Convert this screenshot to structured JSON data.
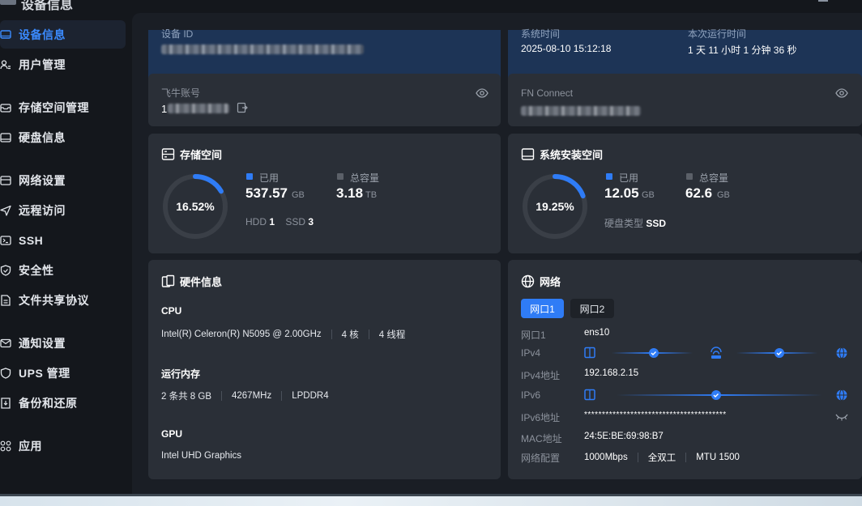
{
  "window": {
    "title": "设备信息"
  },
  "sidebar": {
    "items": [
      {
        "label": "设备信息",
        "icon": "monitor-icon",
        "active": true
      },
      {
        "label": "用户管理",
        "icon": "users-icon"
      },
      {
        "label": "存储空间管理",
        "icon": "storage-icon"
      },
      {
        "label": "硬盘信息",
        "icon": "disk-icon"
      },
      {
        "label": "网络设置",
        "icon": "network-icon"
      },
      {
        "label": "远程访问",
        "icon": "send-icon"
      },
      {
        "label": "SSH",
        "icon": "terminal-icon"
      },
      {
        "label": "安全性",
        "icon": "shield-check-icon"
      },
      {
        "label": "文件共享协议",
        "icon": "file-share-icon"
      },
      {
        "label": "通知设置",
        "icon": "mail-icon"
      },
      {
        "label": "UPS 管理",
        "icon": "shield-icon"
      },
      {
        "label": "备份和还原",
        "icon": "backup-icon"
      },
      {
        "label": "应用",
        "icon": "apps-icon"
      }
    ]
  },
  "device": {
    "id_label": "设备 ID",
    "time_label": "系统时间",
    "time_value": "2025-08-10 15:12:18",
    "uptime_label": "本次运行时间",
    "uptime_value": "1 天 11 小时 1 分钟 36 秒"
  },
  "account": {
    "label": "飞牛账号",
    "value_prefix": "1"
  },
  "fn_connect": {
    "label": "FN Connect"
  },
  "storage": {
    "title": "存储空间",
    "percent_text": "16.52%",
    "percent": 16.52,
    "used_label": "已用",
    "used_value": "537.57",
    "used_unit": "GB",
    "total_label": "总容量",
    "total_value": "3.18",
    "total_unit": "TB",
    "hdd_label": "HDD",
    "hdd_count": "1",
    "ssd_label": "SSD",
    "ssd_count": "3"
  },
  "system_space": {
    "title": "系统安装空间",
    "percent_text": "19.25%",
    "percent": 19.25,
    "used_label": "已用",
    "used_value": "12.05",
    "used_unit": "GB",
    "total_label": "总容量",
    "total_value": "62.6",
    "total_unit": "GB",
    "disk_type_label": "硬盘类型",
    "disk_type_value": "SSD"
  },
  "hardware": {
    "title": "硬件信息",
    "cpu_label": "CPU",
    "cpu_model": "Intel(R) Celeron(R) N5095 @ 2.00GHz",
    "cpu_cores": "4 核",
    "cpu_threads": "4 线程",
    "mem_label": "运行内存",
    "mem_size": "2 条共 8 GB",
    "mem_freq": "4267MHz",
    "mem_type": "LPDDR4",
    "gpu_label": "GPU",
    "gpu_model": "Intel UHD Graphics"
  },
  "network": {
    "title": "网络",
    "tabs": [
      "网口1",
      "网口2"
    ],
    "rows": {
      "port_label": "网口1",
      "port_value": "ens10",
      "ipv4_label": "IPv4",
      "ipv4_addr_label": "IPv4地址",
      "ipv4_addr_value": "192.168.2.15",
      "ipv6_label": "IPv6",
      "ipv6_addr_label": "IPv6地址",
      "ipv6_addr_value": "****************************************",
      "mac_label": "MAC地址",
      "mac_value": "24:5E:BE:69:98:B7",
      "config_label": "网络配置",
      "speed": "1000Mbps",
      "duplex": "全双工",
      "mtu": "MTU 1500"
    }
  },
  "colors": {
    "accent": "#2f7cf6",
    "ring_track": "#3a3f47",
    "card": "#2a2f37",
    "banner": "#1d3456"
  }
}
